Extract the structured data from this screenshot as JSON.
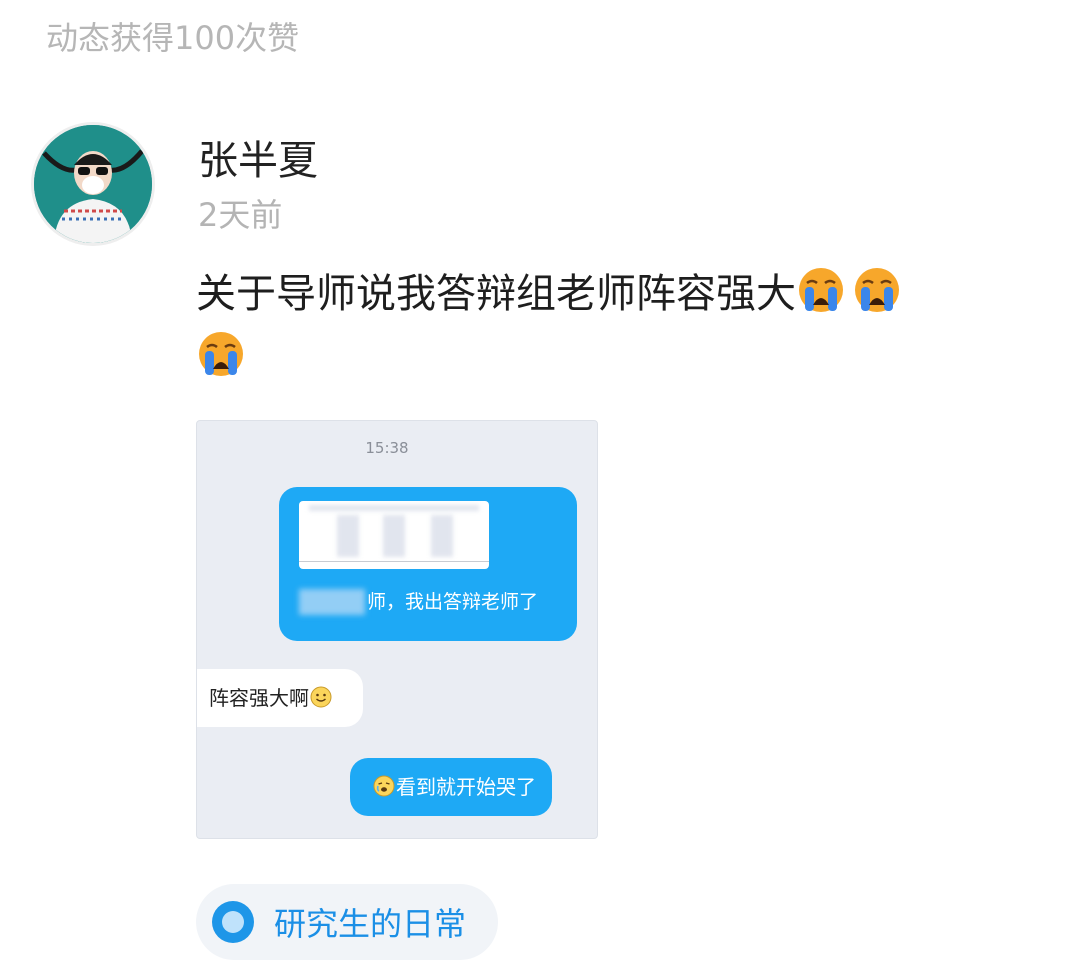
{
  "header": {
    "likes_text": "动态获得100次赞"
  },
  "post": {
    "username": "张半夏",
    "time": "2天前",
    "text": "关于导师说我答辩组老师阵容强大",
    "emojis": [
      "crying-face-icon",
      "crying-face-icon",
      "crying-face-icon"
    ]
  },
  "chat_screenshot": {
    "time": "15:38",
    "message_1": "师，我出答辩老师了",
    "message_2": "阵容强大啊",
    "message_3": "看到就开始哭了"
  },
  "topic": {
    "label": "研究生的日常",
    "icon": "topic-circle-icon"
  },
  "colors": {
    "accent": "#1b8fe6",
    "bubble_blue": "#1ea9f5",
    "muted": "#b6b6b6"
  }
}
